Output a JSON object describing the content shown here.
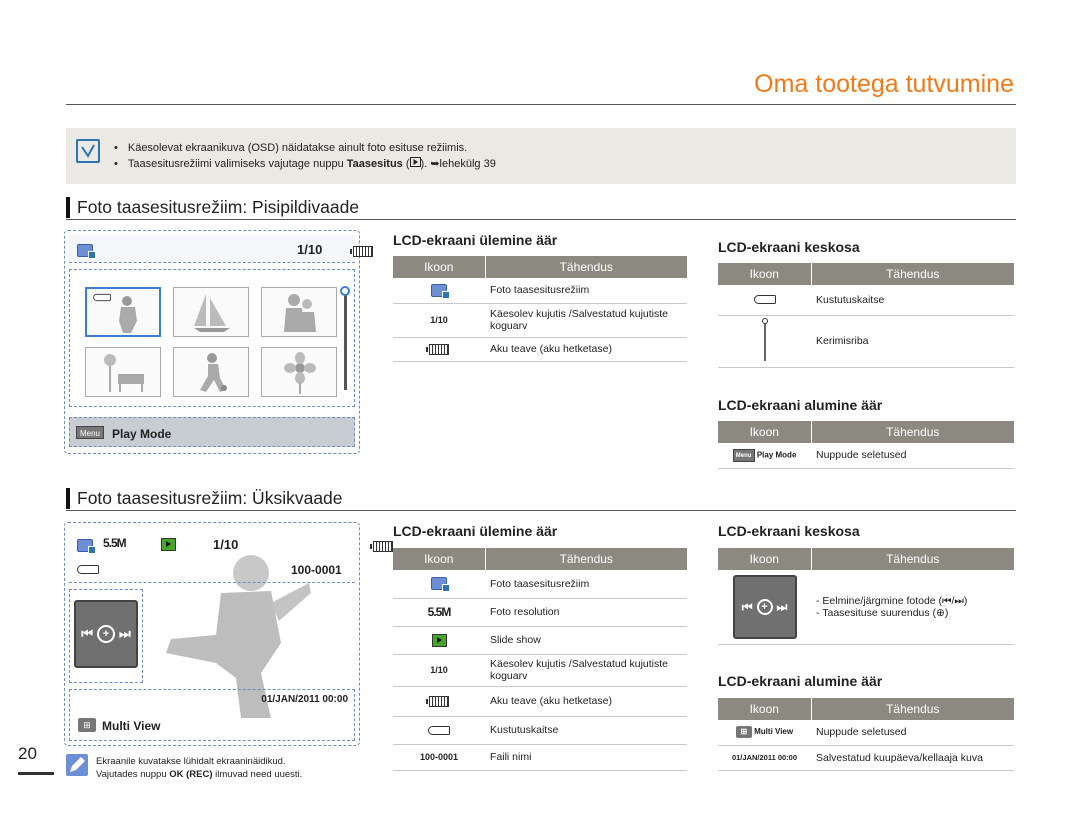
{
  "header": {
    "title": "Oma tootega tutvumine"
  },
  "note": {
    "items": [
      "Käesolevat ekraanikuva (OSD) näidatakse ainult foto esituse režiimis.",
      "Taasesitusrežiimi valimiseks vajutage nuppu"
    ],
    "bold_word": "Taasesitus",
    "ref": "lehekülg 39"
  },
  "thumb_section": {
    "title": "Foto taasesitusrežiim: Pisipildivaade",
    "screen": {
      "counter": "1/10",
      "bottom_label": "Play Mode",
      "menu_icon": "Menu"
    },
    "top_table": {
      "title": "LCD-ekraani ülemine äär",
      "headers": [
        "Ikoon",
        "Tähendus"
      ],
      "rows": [
        {
          "icon": "photo-mode-icon",
          "meaning": "Foto taasesitusrežiim"
        },
        {
          "icon_text": "1/10",
          "meaning": "Käesolev kujutis /Salvestatud kujutiste koguarv"
        },
        {
          "icon": "battery-icon",
          "meaning": "Aku teave (aku hetketase)"
        }
      ]
    },
    "center_table": {
      "title": "LCD-ekraani keskosa",
      "headers": [
        "Ikoon",
        "Tähendus"
      ],
      "rows": [
        {
          "icon": "protect-key-icon",
          "meaning": "Kustutuskaitse"
        },
        {
          "icon": "scrollbar-icon",
          "meaning": "Kerimisriba"
        }
      ]
    },
    "bottom_table": {
      "title": "LCD-ekraani alumine äär",
      "headers": [
        "Ikoon",
        "Tähendus"
      ],
      "rows": [
        {
          "icon_text": "Play Mode",
          "meaning": "Nuppude seletused"
        }
      ]
    }
  },
  "single_section": {
    "title": "Foto taasesitusrežiim: Üksikvaade",
    "screen": {
      "resolution": "5.5M",
      "counter": "1/10",
      "file_number": "100-0001",
      "datetime": "01/JAN/2011 00:00",
      "bottom_label": "Multi View"
    },
    "top_table": {
      "title": "LCD-ekraani ülemine äär",
      "headers": [
        "Ikoon",
        "Tähendus"
      ],
      "rows": [
        {
          "icon": "photo-mode-icon",
          "meaning": "Foto taasesitusrežiim"
        },
        {
          "icon_text": "5.5M",
          "meaning": "Foto resolution"
        },
        {
          "icon": "slideshow-icon",
          "meaning": "Slide show"
        },
        {
          "icon_text": "1/10",
          "meaning": "Käesolev kujutis /Salvestatud kujutiste koguarv"
        },
        {
          "icon": "battery-icon",
          "meaning": "Aku teave (aku hetketase)"
        },
        {
          "icon": "protect-key-icon",
          "meaning": "Kustutuskaitse"
        },
        {
          "icon_text": "100-0001",
          "meaning": "Faili nimi"
        }
      ]
    },
    "center_table": {
      "title": "LCD-ekraani keskosa",
      "headers": [
        "Ikoon",
        "Tähendus"
      ],
      "rows": [
        {
          "icon": "control-pad-icon",
          "meaning_1": "- Eelmine/järgmine fotode (⏮/⏭)",
          "meaning_2": "- Taasesituse suurendus (⊕)"
        }
      ]
    },
    "bottom_table": {
      "title": "LCD-ekraani alumine äär",
      "headers": [
        "Ikoon",
        "Tähendus"
      ],
      "rows": [
        {
          "icon_text": "Multi View",
          "meaning": "Nuppude seletused"
        },
        {
          "icon_text": "01/JAN/2011 00:00",
          "meaning": "Salvestatud kuupäeva/kellaaja kuva"
        }
      ]
    }
  },
  "footer": {
    "page_number": "20",
    "note_line1": "Ekraanile kuvatakse lühidalt ekraaninäidikud.",
    "note_line2_pre": "Vajutades nuppu ",
    "note_line2_bold": "OK (REC)",
    "note_line2_post": " ilmuvad need uuesti."
  }
}
